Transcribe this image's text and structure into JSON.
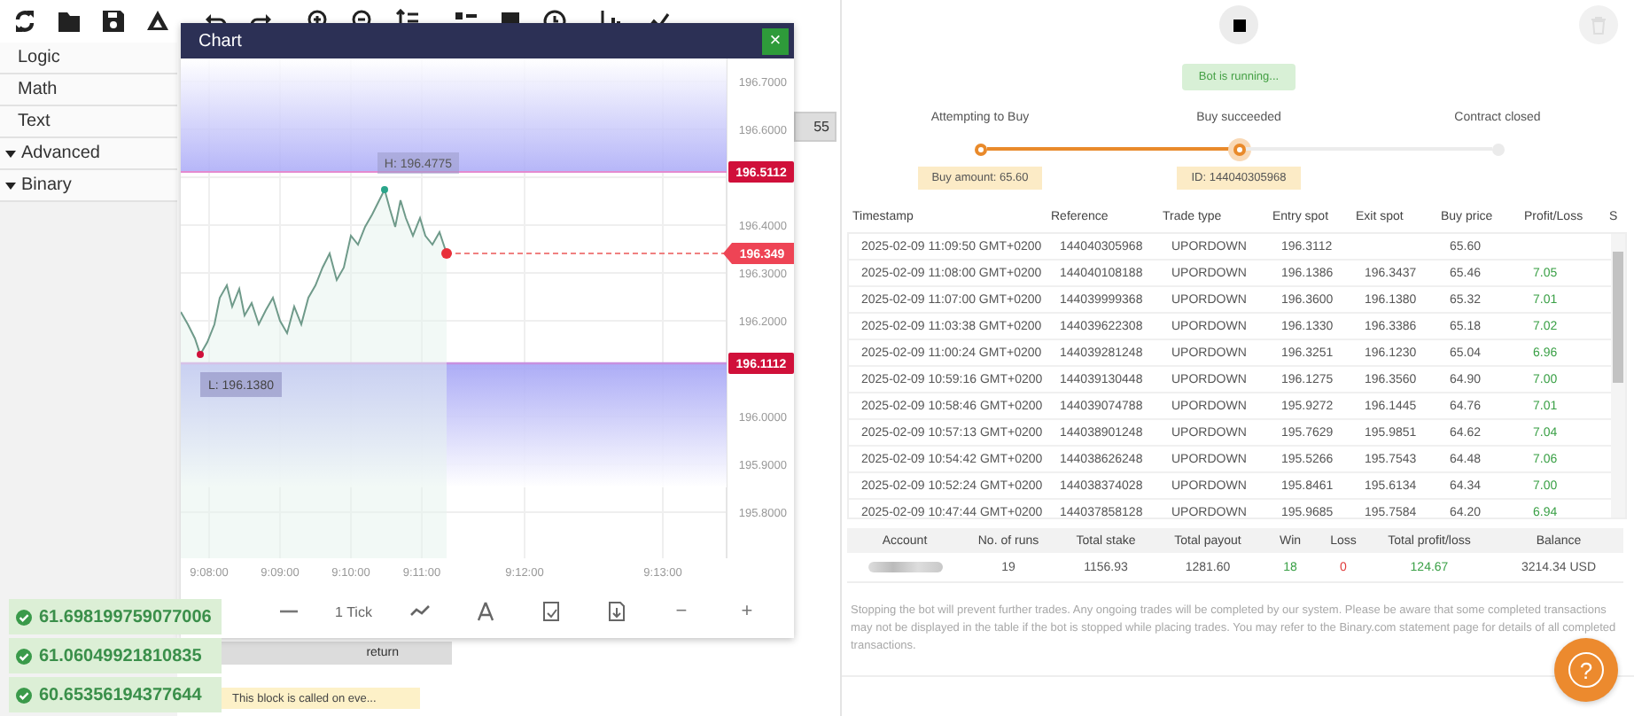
{
  "sidebar": {
    "items": [
      {
        "label": "Logic",
        "has_children": false
      },
      {
        "label": "Math",
        "has_children": false
      },
      {
        "label": "Text",
        "has_children": false
      },
      {
        "label": "Advanced",
        "has_children": true
      },
      {
        "label": "Binary",
        "has_children": true
      }
    ]
  },
  "workspace": {
    "block_value": "55",
    "return_block": "return",
    "comment": "This block is called on eve..."
  },
  "chart_window": {
    "title": "Chart",
    "close": "×",
    "y_axis_labels": [
      "196.7000",
      "196.6000",
      "196.4000",
      "196.3000",
      "196.2000",
      "196.0000",
      "195.9000",
      "195.8000"
    ],
    "x_axis_labels": [
      "9:08:00",
      "9:09:00",
      "9:10:00",
      "9:11:00",
      "9:12:00",
      "9:13:00"
    ],
    "high_label": "H: 196.4775",
    "low_label": "L: 196.1380",
    "barriers": [
      "196.5112",
      "196.1112"
    ],
    "current_price": "196.349",
    "interval": "1 Tick",
    "zoom_out": "−",
    "zoom_in": "+"
  },
  "notifications": [
    "61.698199759077006",
    "61.06049921810835",
    "60.65356194377644"
  ],
  "run_panel": {
    "status": "Bot is running...",
    "steps": [
      {
        "label": "Attempting to Buy",
        "done": true,
        "current": false,
        "tooltip": "Buy amount: 65.60"
      },
      {
        "label": "Buy succeeded",
        "done": true,
        "current": true,
        "tooltip": "ID: 144040305968"
      },
      {
        "label": "Contract closed",
        "done": false,
        "current": false
      }
    ],
    "table": {
      "columns": [
        "Timestamp",
        "Reference",
        "Trade type",
        "Entry spot",
        "Exit spot",
        "Buy price",
        "Profit/Loss",
        "S"
      ],
      "rows": [
        [
          "2025-02-09 11:09:50 GMT+0200",
          "144040305968",
          "UPORDOWN",
          "196.3112",
          null,
          "65.60",
          null
        ],
        [
          "2025-02-09 11:08:00 GMT+0200",
          "144040108188",
          "UPORDOWN",
          "196.1386",
          "196.3437",
          "65.46",
          "7.05"
        ],
        [
          "2025-02-09 11:07:00 GMT+0200",
          "144039999368",
          "UPORDOWN",
          "196.3600",
          "196.1380",
          "65.32",
          "7.01"
        ],
        [
          "2025-02-09 11:03:38 GMT+0200",
          "144039622308",
          "UPORDOWN",
          "196.1330",
          "196.3386",
          "65.18",
          "7.02"
        ],
        [
          "2025-02-09 11:00:24 GMT+0200",
          "144039281248",
          "UPORDOWN",
          "196.3251",
          "196.1230",
          "65.04",
          "6.96"
        ],
        [
          "2025-02-09 10:59:16 GMT+0200",
          "144039130448",
          "UPORDOWN",
          "196.1275",
          "196.3560",
          "64.90",
          "7.00"
        ],
        [
          "2025-02-09 10:58:46 GMT+0200",
          "144039074788",
          "UPORDOWN",
          "195.9272",
          "196.1445",
          "64.76",
          "7.01"
        ],
        [
          "2025-02-09 10:57:13 GMT+0200",
          "144038901248",
          "UPORDOWN",
          "195.7629",
          "195.9851",
          "64.62",
          "7.04"
        ],
        [
          "2025-02-09 10:54:42 GMT+0200",
          "144038626248",
          "UPORDOWN",
          "195.5266",
          "195.7543",
          "64.48",
          "7.06"
        ],
        [
          "2025-02-09 10:52:24 GMT+0200",
          "144038374028",
          "UPORDOWN",
          "195.8461",
          "195.6134",
          "64.34",
          "7.00"
        ],
        [
          "2025-02-09 10:47:44 GMT+0200",
          "144037858128",
          "UPORDOWN",
          "195.9685",
          "195.7584",
          "64.20",
          "6.94"
        ]
      ]
    },
    "summary": {
      "columns": [
        "Account",
        "No. of runs",
        "Total stake",
        "Total payout",
        "Win",
        "Loss",
        "Total profit/loss",
        "Balance"
      ],
      "account_redacted": true,
      "values": [
        "19",
        "1156.93",
        "1281.60",
        "18",
        "0",
        "124.67",
        "3214.34 USD"
      ]
    },
    "disclaimer": "Stopping the bot will prevent further trades. Any ongoing trades will be completed by our system. Please be aware that some completed transactions may not be displayed in the table if the bot is stopped while placing trades. You may refer to the Binary.com statement page for details of all completed transactions.",
    "help_button": "?"
  }
}
